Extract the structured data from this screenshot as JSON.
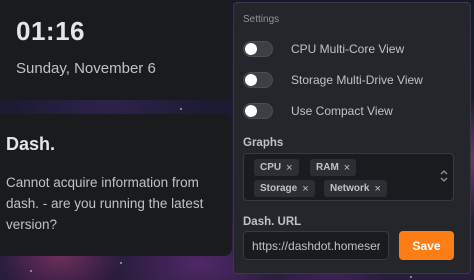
{
  "clock": {
    "time": "01:16",
    "date": "Sunday, November 6"
  },
  "dash_widget": {
    "title": "Dash.",
    "message": "Cannot acquire information from dash. - are you running the latest version?"
  },
  "settings_panel": {
    "heading": "Settings",
    "toggles": [
      {
        "label": "CPU Multi-Core View",
        "checked": false
      },
      {
        "label": "Storage Multi-Drive View",
        "checked": false
      },
      {
        "label": "Use Compact View",
        "checked": false
      }
    ],
    "graphs": {
      "label": "Graphs",
      "selected": [
        "CPU",
        "RAM",
        "Storage",
        "Network"
      ],
      "remove_glyph": "×"
    },
    "url": {
      "label": "Dash. URL",
      "value": "https://dashdot.homeserver"
    },
    "save_label": "Save"
  },
  "colors": {
    "panel_bg": "#25262b",
    "card_bg": "#1a1b1e",
    "accent": "#fd7e14",
    "text": "#c1c2c5"
  }
}
